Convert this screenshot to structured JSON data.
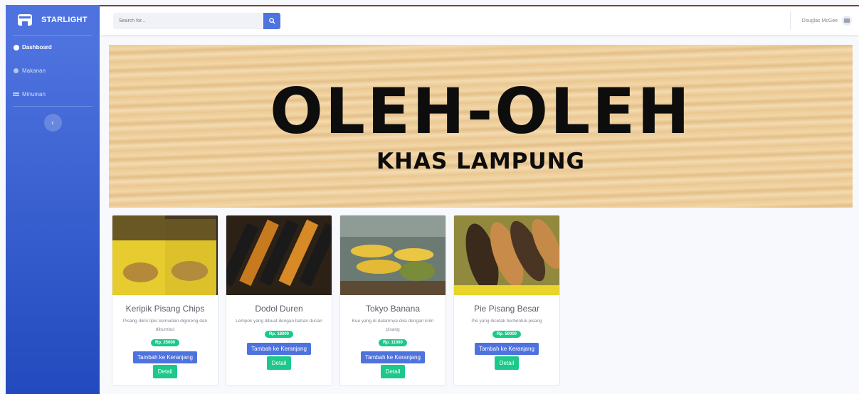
{
  "sidebar": {
    "brand": "STARLIGHT",
    "items": [
      {
        "label": "Dashboard",
        "icon": "gauge-icon",
        "active": true
      },
      {
        "label": "Makanan",
        "icon": "circle-icon",
        "active": false
      },
      {
        "label": "Minuman",
        "icon": "cups-icon",
        "active": false
      }
    ],
    "toggle_icon": "‹"
  },
  "topbar": {
    "search_placeholder": "Search for...",
    "user_name": "Douglas McGee"
  },
  "banner": {
    "title": "OLEH-OLEH",
    "subtitle": "KHAS LAMPUNG"
  },
  "products": [
    {
      "name": "Keripik Pisang Chips",
      "description": "Pisang diiris tipis kemudian digoreng dan dibumbui",
      "price": "Rp. 25000",
      "cart_label": "Tambah ke Keranjang",
      "detail_label": "Detail"
    },
    {
      "name": "Dodol Duren",
      "description": "Lempok yang dibuat dengan bahan durian",
      "price": "Rp. 18000",
      "cart_label": "Tambah ke Keranjang",
      "detail_label": "Detail"
    },
    {
      "name": "Tokyo Banana",
      "description": "Kue yang di dalamnya diisi dengan krim pisang",
      "price": "Rp. 11000",
      "cart_label": "Tambah ke Keranjang",
      "detail_label": "Detail"
    },
    {
      "name": "Pie Pisang Besar",
      "description": "Pie yang dicetak berbentuk pisang",
      "price": "Rp. 50000",
      "cart_label": "Tambah ke Keranjang",
      "detail_label": "Detail"
    }
  ],
  "colors": {
    "primary": "#4e73df",
    "success": "#1cc88a",
    "text_muted": "#858796"
  }
}
